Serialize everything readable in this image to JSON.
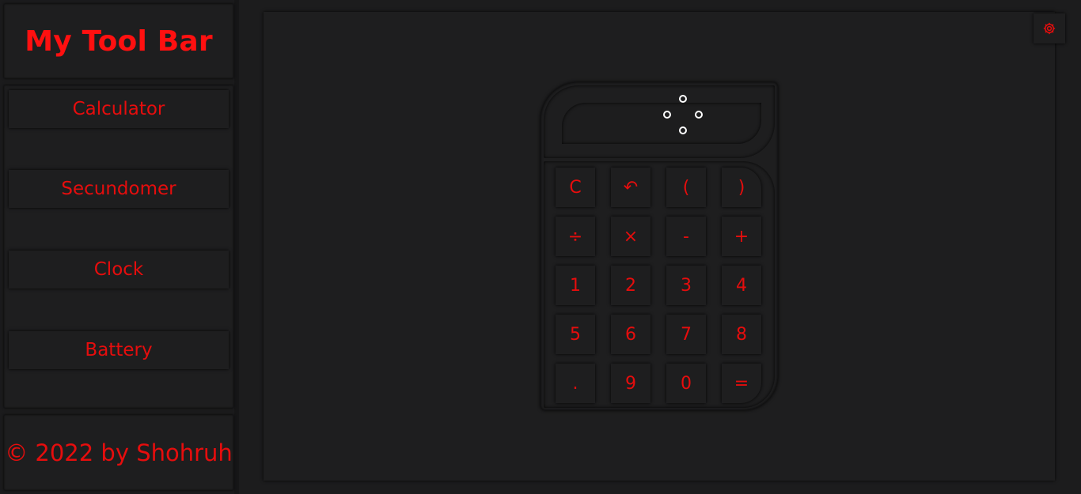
{
  "sidebar": {
    "brand": "My Tool Bar",
    "items": [
      {
        "label": "Calculator"
      },
      {
        "label": "Secundomer"
      },
      {
        "label": "Clock"
      },
      {
        "label": "Battery"
      }
    ],
    "footer": "© 2022 by Shohruh"
  },
  "main": {
    "settings_icon": "gear-icon"
  },
  "calculator": {
    "display_value": "",
    "loading_indicator": "spinner-dots",
    "keys": [
      [
        "C",
        "↶",
        "(",
        ")"
      ],
      [
        "÷",
        "×",
        "-",
        "+"
      ],
      [
        "1",
        "2",
        "3",
        "4"
      ],
      [
        "5",
        "6",
        "7",
        "8"
      ],
      [
        ".",
        "9",
        "0",
        "="
      ]
    ]
  },
  "colors": {
    "accent": "#e60d0d",
    "background": "#1c1c1d",
    "panel": "#1e1e1f"
  }
}
